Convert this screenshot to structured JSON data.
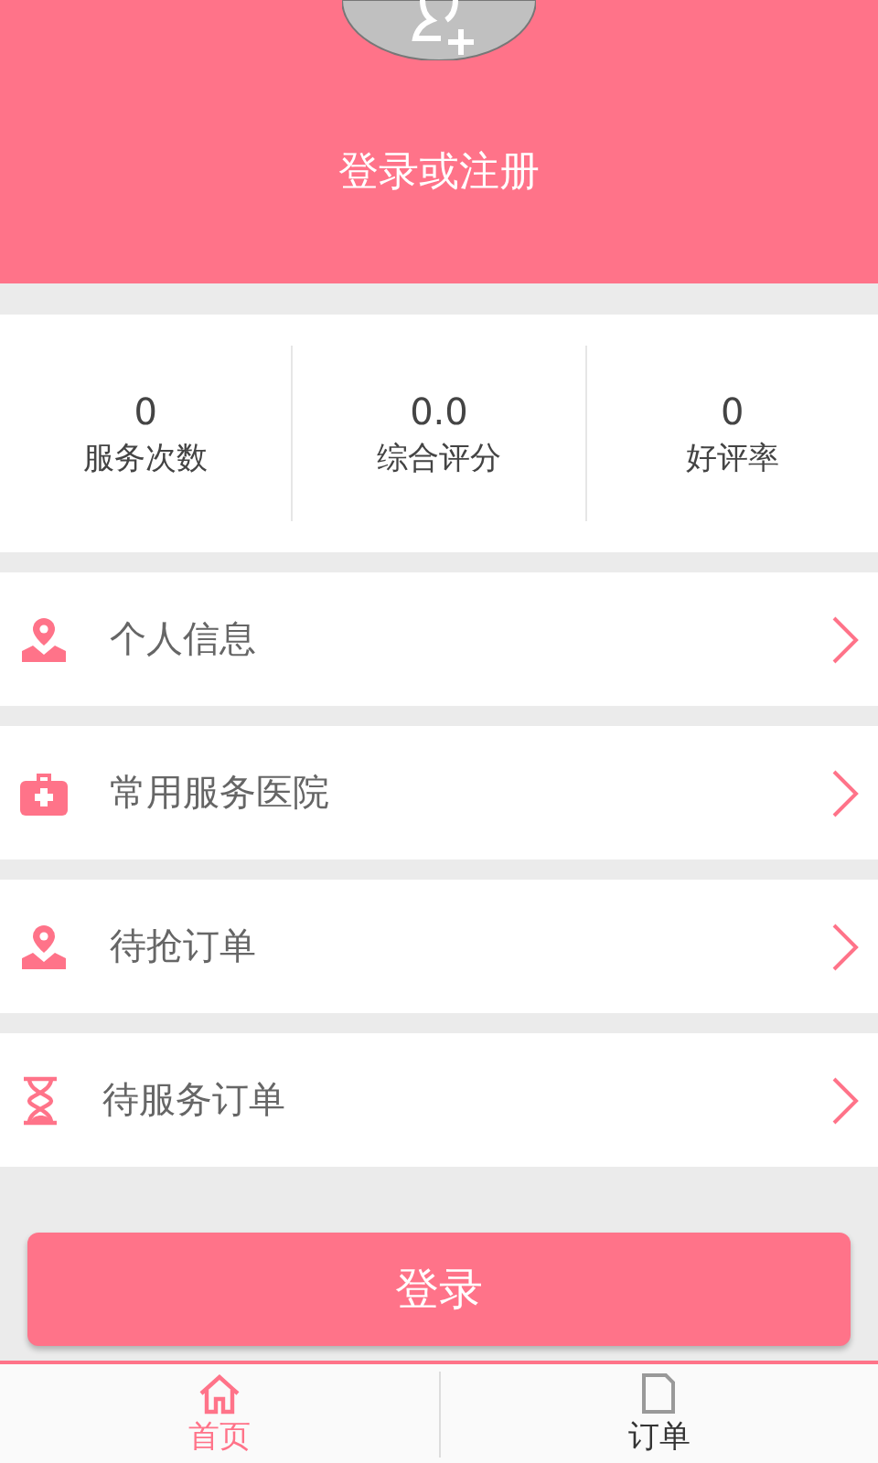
{
  "header": {
    "login_prompt": "登录或注册"
  },
  "stats": [
    {
      "value": "0",
      "label": "服务次数"
    },
    {
      "value": "0.0",
      "label": "综合评分"
    },
    {
      "value": "0",
      "label": "好评率"
    }
  ],
  "menu": [
    {
      "kind": "person",
      "label": "个人信息"
    },
    {
      "kind": "kit",
      "label": "常用服务医院"
    },
    {
      "kind": "person",
      "label": "待抢订单"
    },
    {
      "kind": "hourglass",
      "label": "待服务订单"
    }
  ],
  "login_button": "登录",
  "tabs": [
    {
      "kind": "home",
      "label": "首页",
      "selected": true
    },
    {
      "kind": "order",
      "label": "订单",
      "selected": false
    }
  ]
}
